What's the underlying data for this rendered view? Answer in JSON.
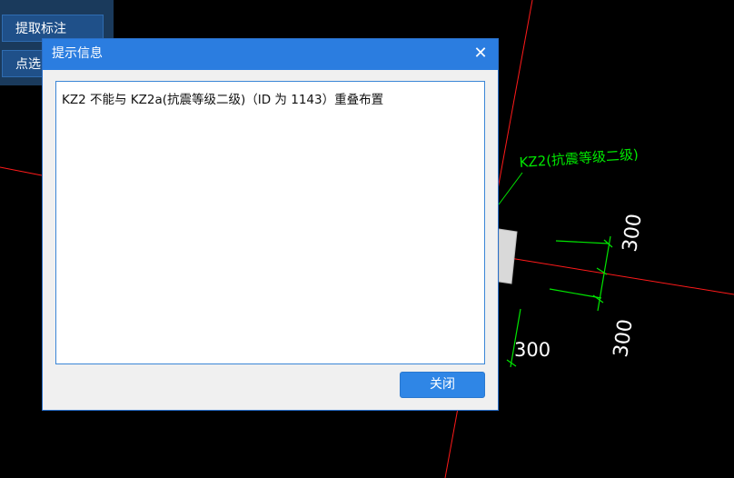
{
  "side_panel": {
    "extract_label": "提取标注",
    "pick_label": "点选"
  },
  "dialog": {
    "title": "提示信息",
    "close_glyph": "✕",
    "message": "KZ2 不能与 KZ2a(抗震等级二级)（ID 为 1143）重叠布置",
    "button_label": "关闭"
  },
  "cad": {
    "label": "KZ2(抗震等级二级)",
    "dim_right_top": "300",
    "dim_right_bottom": "300",
    "dim_center": "300"
  },
  "colors": {
    "dialog_title_bar": "#2b7de0",
    "cad_red": "#ff1a1a",
    "cad_green": "#00e600"
  }
}
